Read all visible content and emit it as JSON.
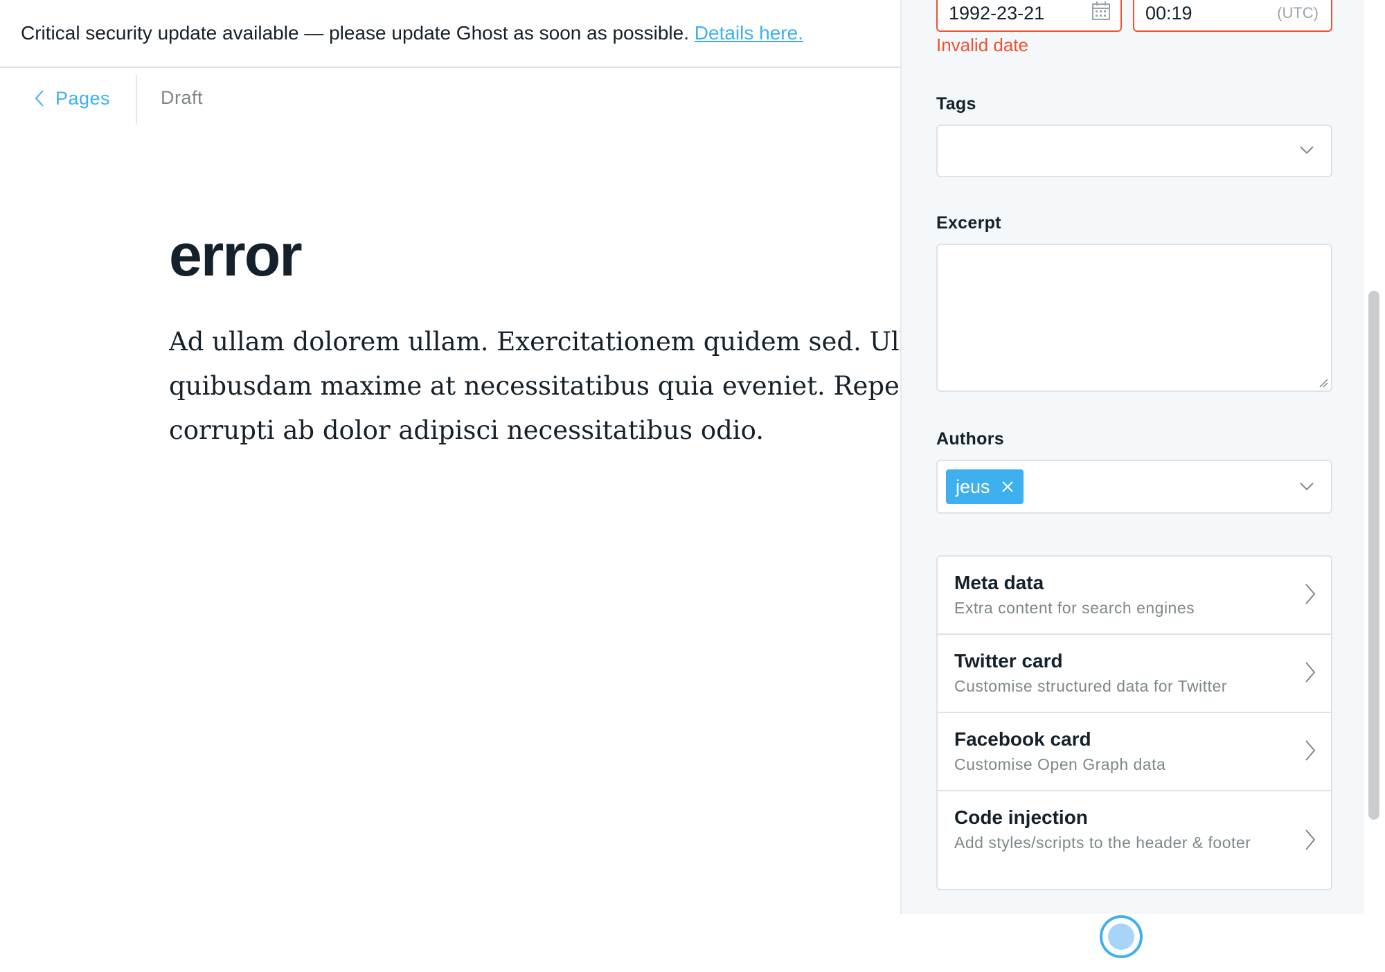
{
  "banner": {
    "message": "Critical security update available — please update Ghost as soon as possible.",
    "link_text": "Details here."
  },
  "breadcrumb": {
    "back_label": "Pages",
    "status": "Draft"
  },
  "editor": {
    "title": "error",
    "body_lines": [
      "Ad ullam dolorem ullam. Exercitationem quidem sed. Ullam",
      "quibusdam maxime at necessitatibus quia eveniet. Repellendus",
      "corrupti ab dolor adipisci necessitatibus odio."
    ]
  },
  "settings": {
    "publish_date": "1992-23-21",
    "publish_time": "00:19",
    "timezone": "(UTC)",
    "date_error": "Invalid date",
    "tags_label": "Tags",
    "excerpt_label": "Excerpt",
    "authors_label": "Authors",
    "authors": [
      "jeus"
    ],
    "sections": [
      {
        "title": "Meta data",
        "description": "Extra content for search engines"
      },
      {
        "title": "Twitter card",
        "description": "Customise structured data for Twitter"
      },
      {
        "title": "Facebook card",
        "description": "Customise Open Graph data"
      },
      {
        "title": "Code injection",
        "description": "Add styles/scripts to the header & footer"
      }
    ]
  },
  "colors": {
    "accent": "#3eb0ef",
    "error": "#f05230",
    "panel_bg": "#f4f8fb"
  },
  "icons": [
    "chevron-left-icon",
    "calendar-icon",
    "chevron-down-icon",
    "close-icon",
    "chevron-right-icon",
    "resize-grip-icon",
    "loading-spinner-icon"
  ]
}
